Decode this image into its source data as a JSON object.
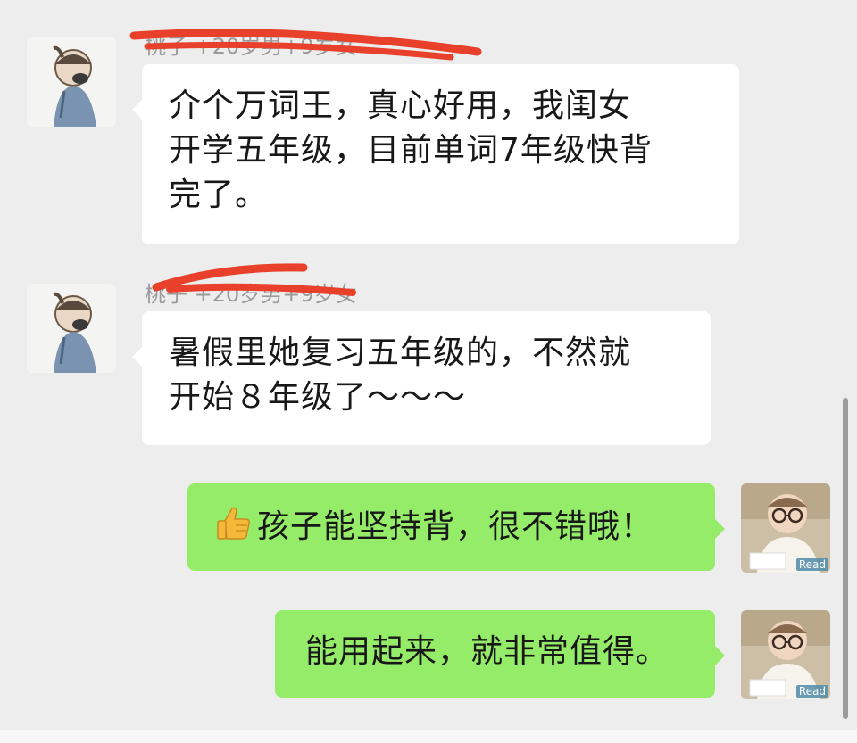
{
  "messages": [
    {
      "direction": "incoming",
      "sender": "桃子 +20岁男+9岁女",
      "text_lines": [
        "介个万词王，真心好用，我闺女",
        "开学五年级，目前单词7年级快背",
        "完了。"
      ]
    },
    {
      "direction": "incoming",
      "sender": "桃子 +20岁男+9岁女",
      "text_lines": [
        "暑假里她复习五年级的，不然就",
        "开始８年级了～～～"
      ]
    },
    {
      "direction": "outgoing",
      "emoji": "thumbs-up-icon",
      "text": "孩子能坚持背，很不错哦！",
      "status": "Read"
    },
    {
      "direction": "outgoing",
      "text": "能用起来，就非常值得。",
      "status": "Read"
    }
  ],
  "colors": {
    "background": "#ededed",
    "incoming_bubble": "#ffffff",
    "outgoing_bubble": "#95ec69",
    "sender_text": "#9a9a9a",
    "message_text": "#181818",
    "redaction": "#e8402b"
  }
}
